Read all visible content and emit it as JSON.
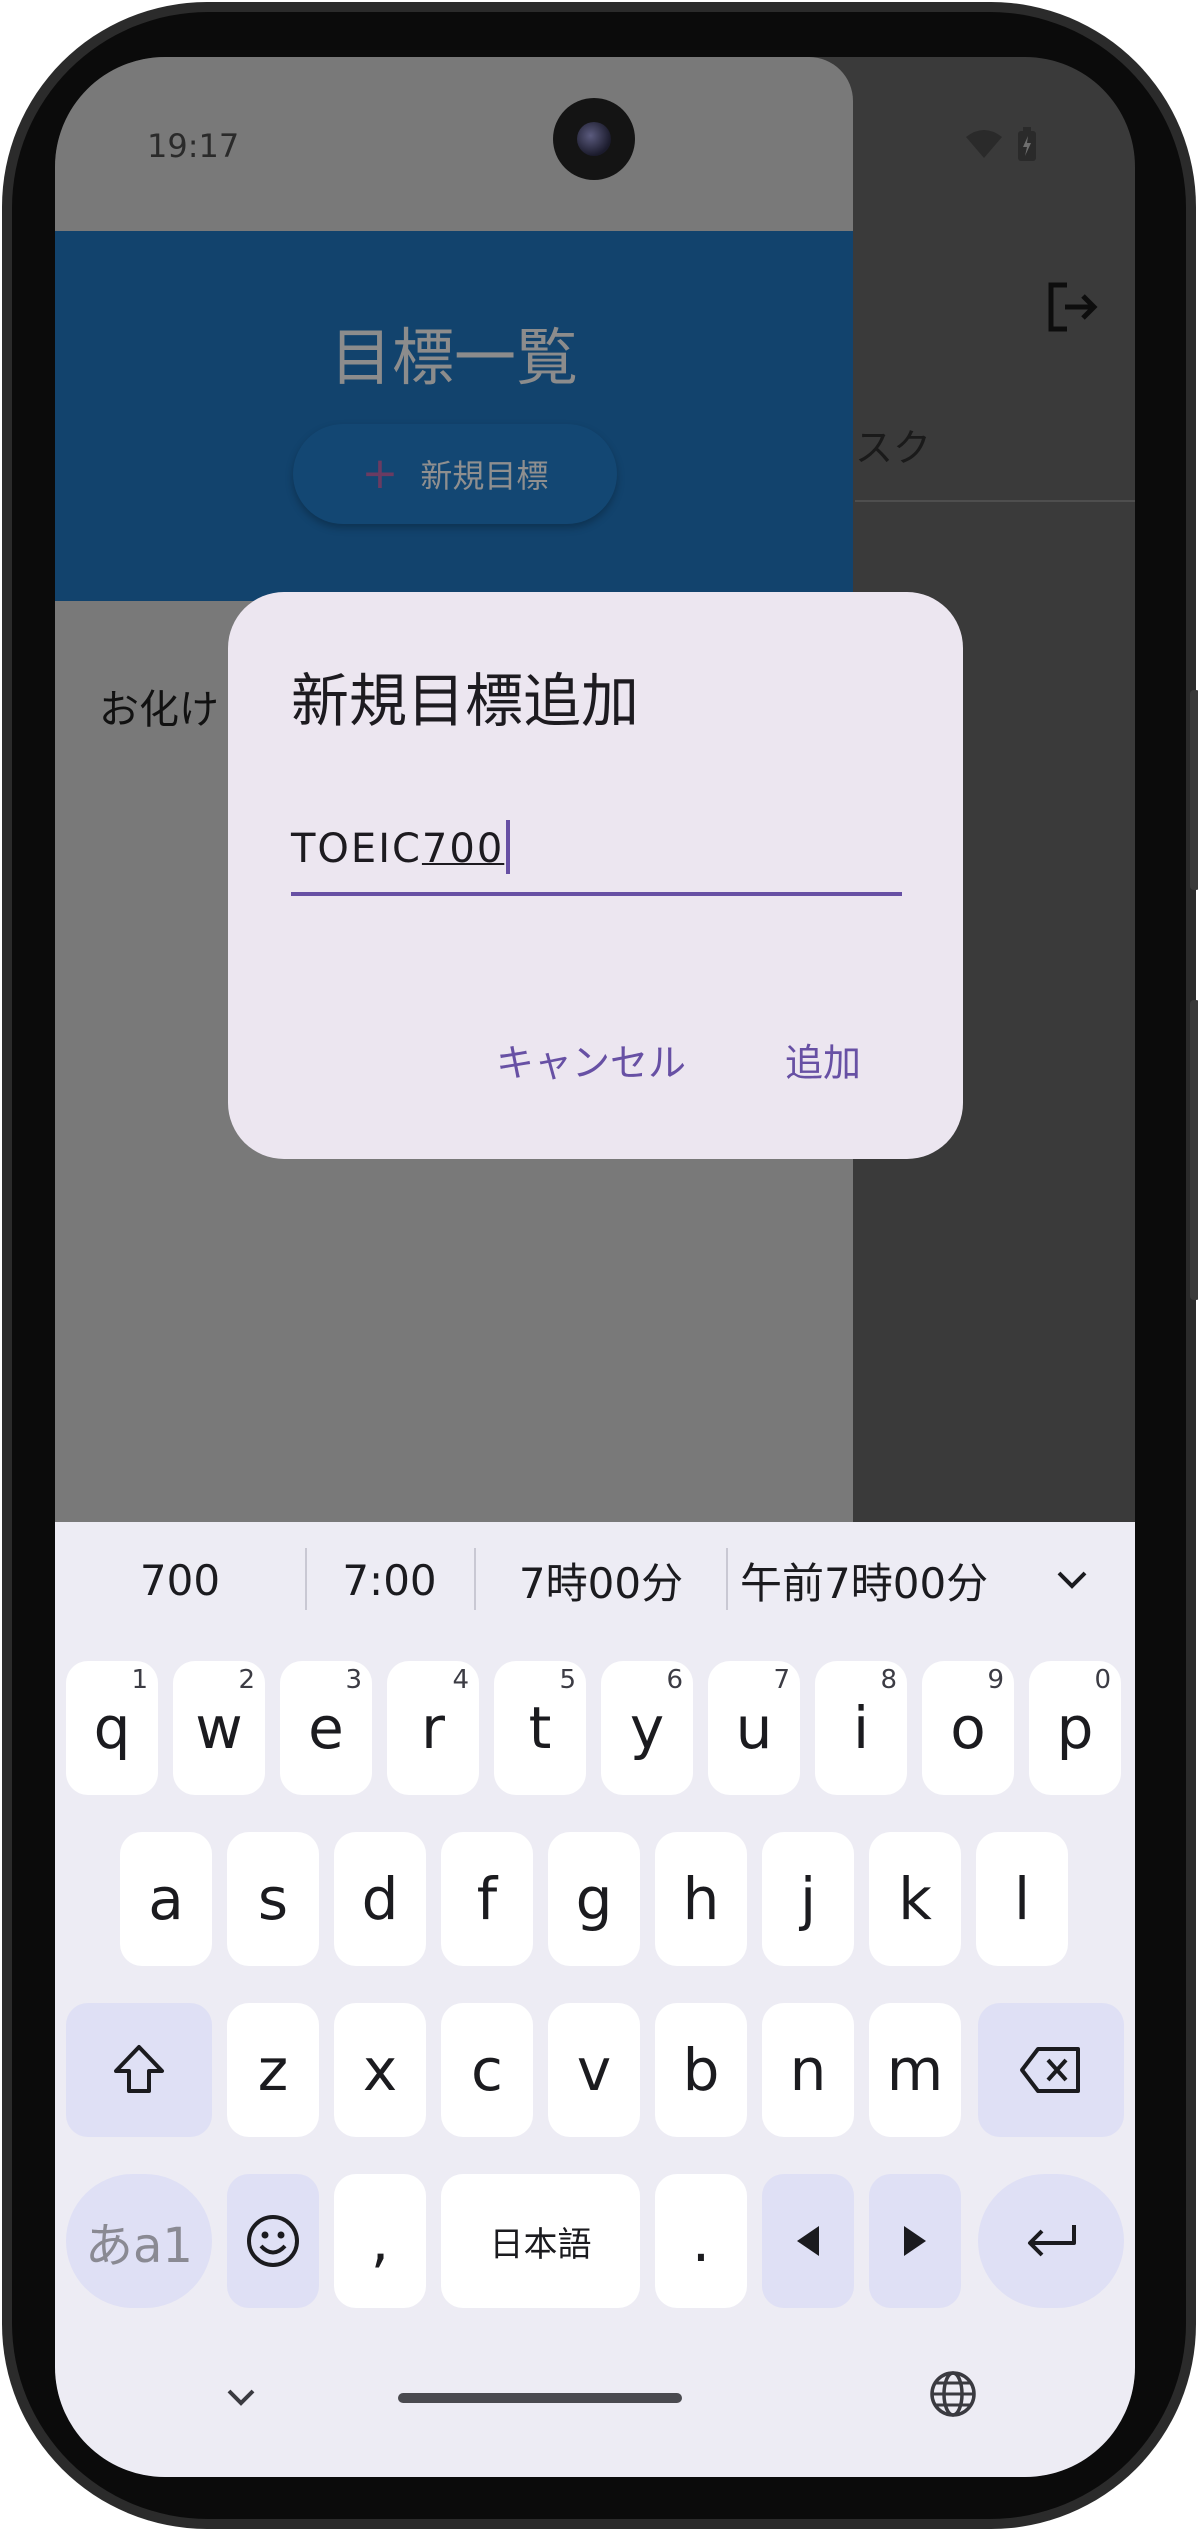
{
  "status_bar": {
    "time": "19:17",
    "icons": [
      "wifi-icon",
      "battery-charging-icon"
    ]
  },
  "drawer": {
    "title": "目標一覧",
    "new_goal_button": "新規目標",
    "items": [
      "お化け"
    ]
  },
  "background": {
    "tab_label_partial": "スク",
    "actions": [
      "logout-icon"
    ]
  },
  "dialog": {
    "title": "新規目標追加",
    "input_committed": "TOEIC",
    "input_composing": "700",
    "cancel_label": "キャンセル",
    "add_label": "追加"
  },
  "keyboard": {
    "suggestions": [
      "700",
      "7:00",
      "7時00分",
      "午前7時00分"
    ],
    "row1": [
      {
        "key": "q",
        "hint": "1"
      },
      {
        "key": "w",
        "hint": "2"
      },
      {
        "key": "e",
        "hint": "3"
      },
      {
        "key": "r",
        "hint": "4"
      },
      {
        "key": "t",
        "hint": "5"
      },
      {
        "key": "y",
        "hint": "6"
      },
      {
        "key": "u",
        "hint": "7"
      },
      {
        "key": "i",
        "hint": "8"
      },
      {
        "key": "o",
        "hint": "9"
      },
      {
        "key": "p",
        "hint": "0"
      }
    ],
    "row2": [
      "a",
      "s",
      "d",
      "f",
      "g",
      "h",
      "j",
      "k",
      "l"
    ],
    "row3": [
      "z",
      "x",
      "c",
      "v",
      "b",
      "n",
      "m"
    ],
    "mode_key": "あa1",
    "comma": ",",
    "space_label": "日本語",
    "period": "."
  },
  "colors": {
    "accent": "#6750a4",
    "drawer_header": "#12436d",
    "dialog_bg": "#ece6f0",
    "keyboard_bg": "#edecf4"
  }
}
